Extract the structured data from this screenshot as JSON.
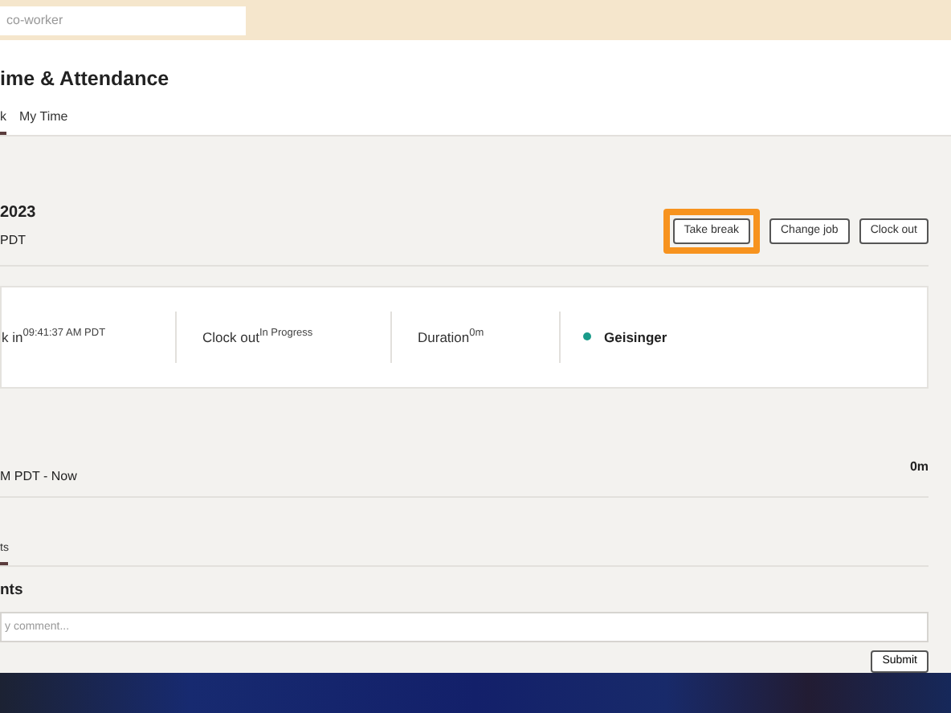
{
  "search": {
    "placeholder": "co-worker"
  },
  "header": {
    "title": "ime & Attendance",
    "tabs": [
      {
        "label": "k",
        "selected": true
      },
      {
        "label": "My Time",
        "selected": false
      }
    ]
  },
  "shift": {
    "date": "2023",
    "time": "PDT",
    "buttons": [
      {
        "label": "Take break",
        "highlighted": true
      },
      {
        "label": "Change job",
        "highlighted": false
      },
      {
        "label": "Clock out",
        "highlighted": false
      }
    ]
  },
  "summary": {
    "fields": [
      {
        "label": "k in",
        "value": "09:41:37 AM PDT"
      },
      {
        "label": "Clock out",
        "value": "In Progress"
      },
      {
        "label": "Duration",
        "value": "0m"
      }
    ],
    "job": {
      "name": "Geisinger",
      "color": "#1a9b8a"
    }
  },
  "entry": {
    "range": "M PDT - Now",
    "duration": "0m"
  },
  "lower_tabs": [
    {
      "label": "ts",
      "selected": true
    }
  ],
  "comments": {
    "heading": "nts",
    "placeholder": "y comment...",
    "submit": "Submit"
  }
}
